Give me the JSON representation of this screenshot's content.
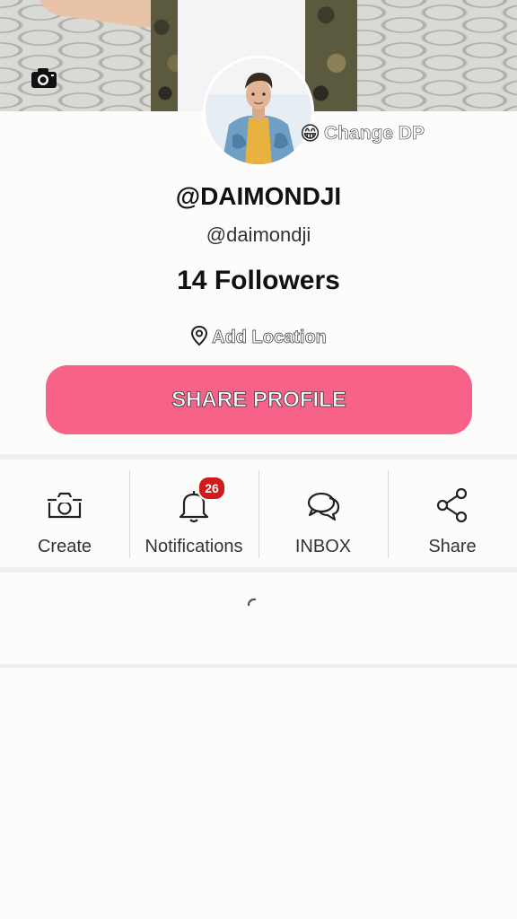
{
  "profile": {
    "display_name": "@DAIMONDJI",
    "username": "@daimondji",
    "followers": "14 Followers",
    "change_dp_emoji": "😁",
    "change_dp_label": "Change DP",
    "add_location_label": "Add Location",
    "share_profile_label": "SHARE PROFILE"
  },
  "actions": [
    {
      "label": "Create",
      "icon": "camera-outline-icon"
    },
    {
      "label": "Notifications",
      "icon": "bell-icon",
      "badge": "26"
    },
    {
      "label": "INBOX",
      "icon": "chat-bubbles-icon"
    },
    {
      "label": "Share",
      "icon": "share-icon"
    }
  ],
  "colors": {
    "share_button": "#f76388",
    "badge": "#d11b1b"
  }
}
